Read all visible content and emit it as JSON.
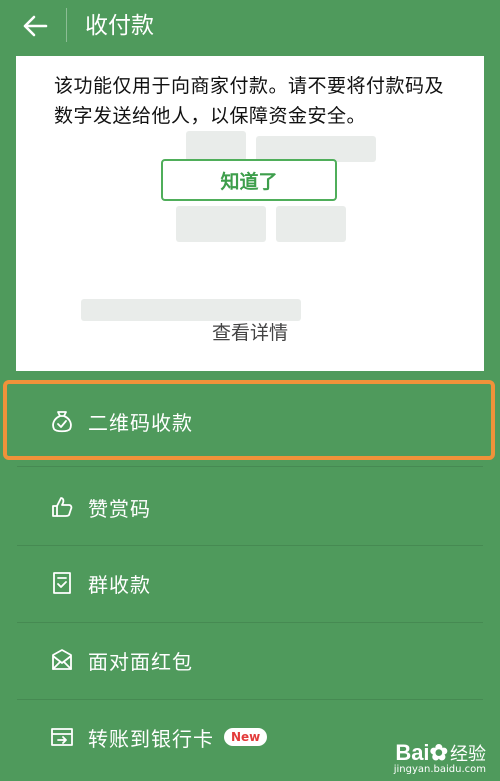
{
  "header": {
    "title": "收付款"
  },
  "notice": {
    "text": "该功能仅用于向商家付款。请不要将付款码及数字发送给他人，以保障资金安全。",
    "confirm_label": "知道了",
    "details_label": "查看详情"
  },
  "menu": {
    "items": [
      {
        "label": "二维码收款",
        "icon": "receive-money-bag-icon"
      },
      {
        "label": "赞赏码",
        "icon": "thumbs-up-icon"
      },
      {
        "label": "群收款",
        "icon": "group-receipt-icon"
      },
      {
        "label": "面对面红包",
        "icon": "red-envelope-icon"
      },
      {
        "label": "转账到银行卡",
        "icon": "bank-card-transfer-icon",
        "badge": "New"
      }
    ]
  },
  "watermark": {
    "logo_prefix": "Bai",
    "logo_suffix": "经验",
    "url": "jingyan.baidu.com"
  },
  "colors": {
    "background": "#4f9a5c",
    "highlight": "#f0923a",
    "button_border": "#4fae5a"
  }
}
